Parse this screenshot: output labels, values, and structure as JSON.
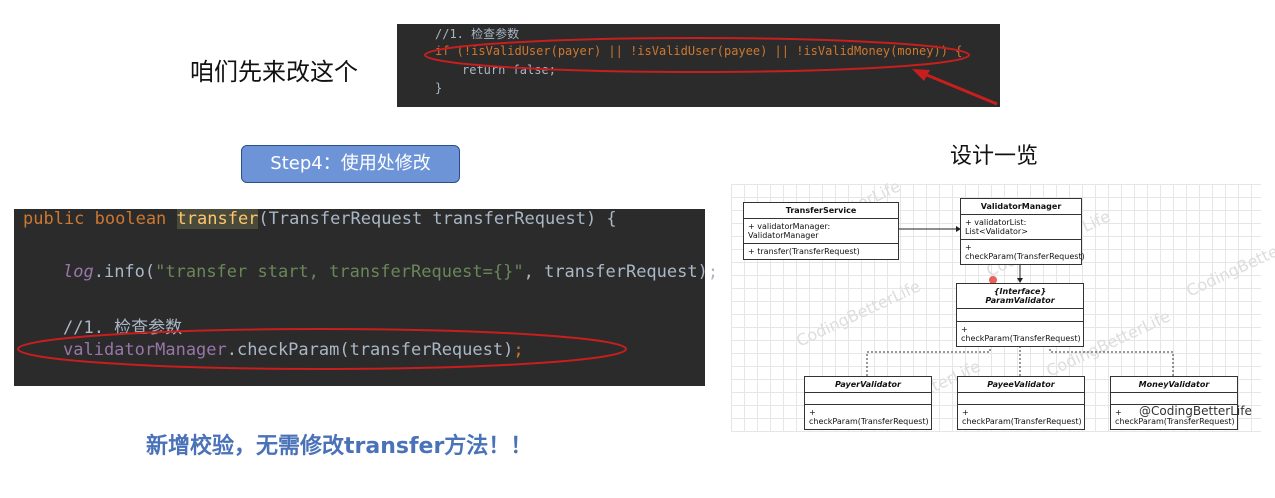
{
  "top_left_caption": "咱们先来改这个",
  "code_top": {
    "comment": "//1. 检查参数",
    "if_line": "if (!isValidUser(payer) || !isValidUser(payee) || !isValidMoney(money)) {",
    "return_line": "return false;",
    "close_brace": "}"
  },
  "step_button": "Step4：使用处修改",
  "code_main": {
    "sig_kw": "public boolean ",
    "sig_fn": "transfer",
    "sig_rest": "(TransferRequest transferRequest) {",
    "log_obj": "log",
    "log_call": ".info(",
    "log_str": "\"transfer start, transferRequest={}\"",
    "log_rest": ", transferRequest);",
    "comment": "//1. 检查参数",
    "vm_field": "validatorManager",
    "vm_call": ".checkParam(transferRequest)",
    "vm_semi": ";"
  },
  "banner": "新增校验，无需修改transfer方法！！",
  "design_title": "设计一览",
  "diagram": {
    "transfer_service": {
      "name": "TransferService",
      "attr": "+ validatorManager: ValidatorManager",
      "op": "+ transfer(TransferRequest)"
    },
    "validator_manager": {
      "name": "ValidatorManager",
      "attr": "+ validatorList: List<Validator>",
      "op": "+ checkParam(TransferRequest)"
    },
    "param_validator": {
      "stereotype": "{Interface}",
      "name": "ParamValidator",
      "op": "+ checkParam(TransferRequest)"
    },
    "payer_validator": {
      "name": "PayerValidator",
      "op": "+ checkParam(TransferRequest)"
    },
    "payee_validator": {
      "name": "PayeeValidator",
      "op": "+ checkParam(TransferRequest)"
    },
    "money_validator": {
      "name": "MoneyValidator",
      "op": "+ checkParam(TransferRequest)"
    },
    "watermark": "CodingBetterLife"
  },
  "credit": "@CodingBetterLife",
  "colors": {
    "annotation_red": "#c81e1e",
    "code_bg": "#2b2b2b",
    "step_bg": "#6e94d8",
    "banner": "#4a72b8"
  }
}
